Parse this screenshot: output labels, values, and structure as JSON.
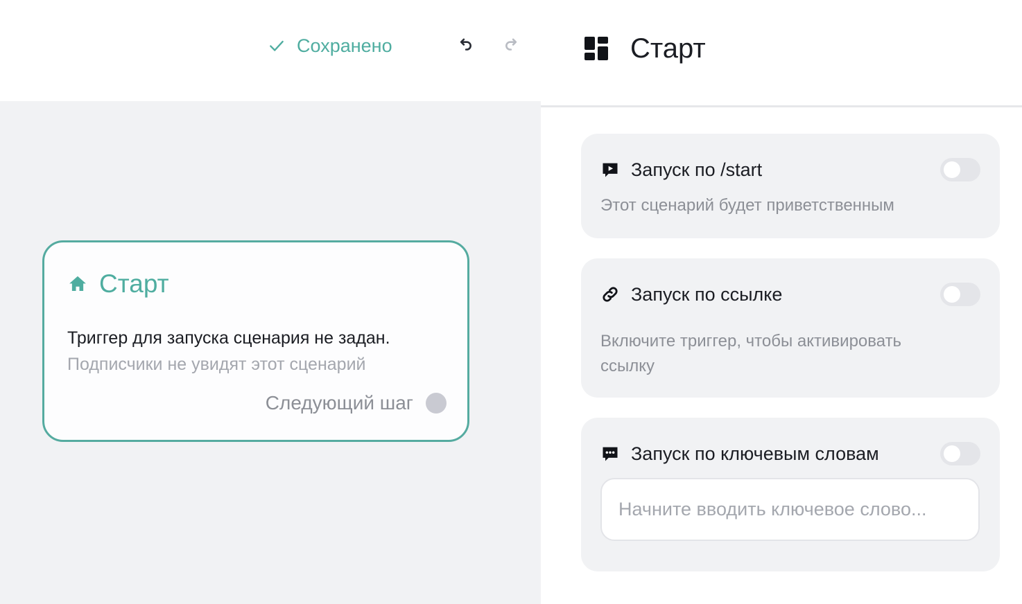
{
  "editor": {
    "save_status": "Сохранено",
    "node": {
      "title": "Старт",
      "trigger_text": "Триггер для запуска сценария не задан.",
      "subtitle": "Подписчики не увидят этот сценарий",
      "next_step": "Следующий шаг"
    }
  },
  "panel": {
    "title": "Старт",
    "triggers": [
      {
        "label": "Запуск по /start",
        "description": "Этот сценарий будет приветственным",
        "enabled": false,
        "icon": "play-message-icon"
      },
      {
        "label": "Запуск по ссылке",
        "description": "Включите триггер, чтобы активировать ссылку",
        "enabled": false,
        "icon": "link-icon"
      },
      {
        "label": "Запуск по ключевым словам",
        "placeholder": "Начните вводить ключевое слово...",
        "value": "",
        "enabled": false,
        "icon": "chat-dots-icon"
      }
    ]
  },
  "colors": {
    "accent": "#4fada0",
    "node_border": "#55aba0",
    "canvas": "#f1f2f4",
    "muted_text": "#a4a7ae"
  }
}
